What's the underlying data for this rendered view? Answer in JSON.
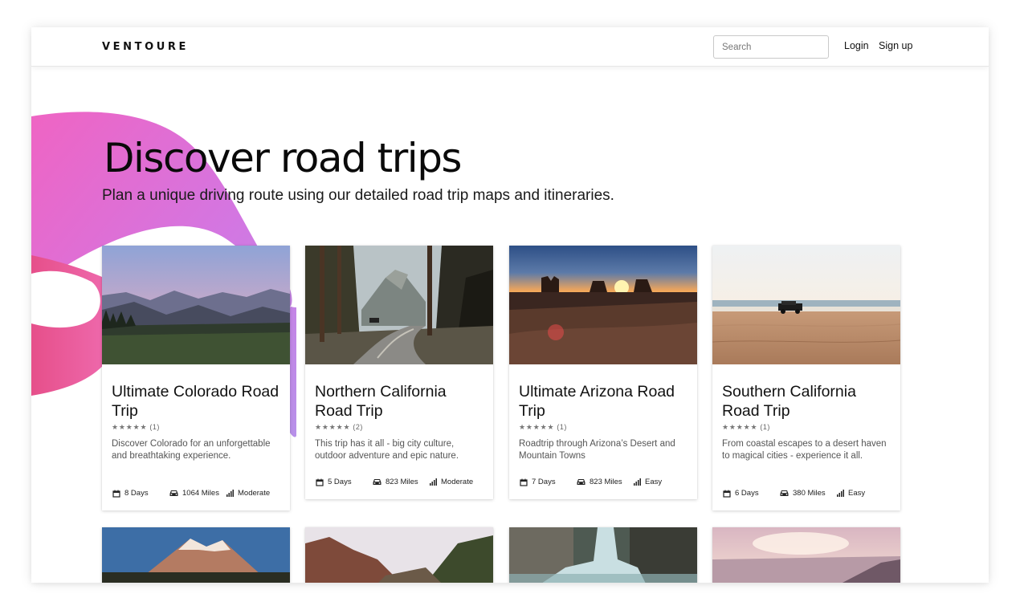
{
  "app": {
    "brand": "VENTOURE"
  },
  "header": {
    "search_placeholder": "Search",
    "login_label": "Login",
    "signup_label": "Sign up"
  },
  "hero": {
    "title": "Discover road trips",
    "subtitle": "Plan a unique driving route using our detailed road trip maps and itineraries."
  },
  "colors": {
    "ribbon_pink": "#e0409a",
    "ribbon_purple": "#b48be8",
    "text_dark": "#111111"
  },
  "trips": [
    {
      "title": "Ultimate Colorado Road Trip",
      "stars": "★★★★★",
      "reviews": "(1)",
      "description": "Discover Colorado for an unforgettable and breathtaking experience.",
      "days": "8 Days",
      "miles": "1064 Miles",
      "difficulty": "Moderate",
      "photo": "mountain-valley-photo"
    },
    {
      "title": "Northern California Road Trip",
      "stars": "★★★★★",
      "reviews": "(2)",
      "description": "This trip has it all - big city culture, outdoor adventure and epic nature.",
      "days": "5 Days",
      "miles": "823 Miles",
      "difficulty": "Moderate",
      "photo": "forest-road-photo"
    },
    {
      "title": "Ultimate Arizona Road Trip",
      "stars": "★★★★★",
      "reviews": "(1)",
      "description": "Roadtrip through Arizona’s Desert and Mountain Towns",
      "days": "7 Days",
      "miles": "823 Miles",
      "difficulty": "Easy",
      "photo": "desert-sunset-photo"
    },
    {
      "title": "Southern California Road Trip",
      "stars": "★★★★★",
      "reviews": "(1)",
      "description": "From coastal escapes to a desert haven to magical cities - experience it all.",
      "days": "6 Days",
      "miles": "380 Miles",
      "difficulty": "Easy",
      "photo": "beach-jeep-photo"
    }
  ],
  "more_trip_photos": [
    "snowy-peak-photo",
    "canyon-photo",
    "waterfall-photo",
    "coast-sunset-photo"
  ]
}
